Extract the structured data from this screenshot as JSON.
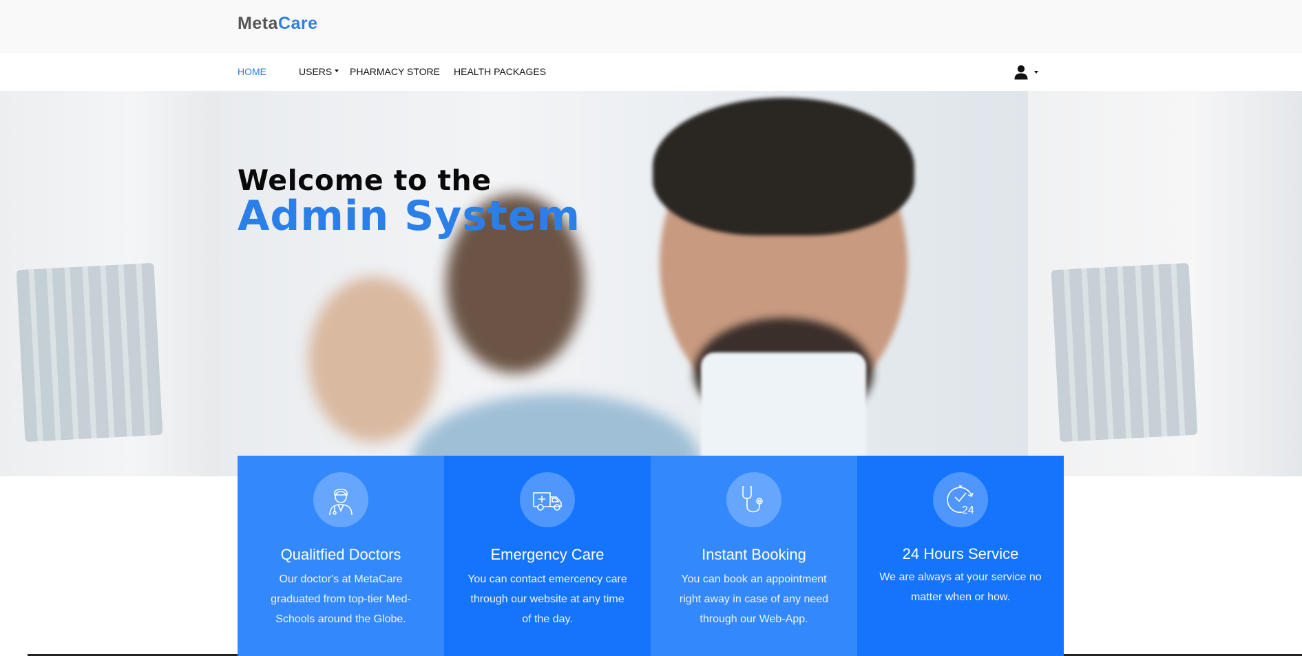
{
  "brand": {
    "part1": "Meta",
    "part2": "Care"
  },
  "nav": {
    "home": "HOME",
    "users": "USERS",
    "pharmacy": "PHARMACY STORE",
    "packages": "HEALTH PACKAGES"
  },
  "hero": {
    "line1": "Welcome to the",
    "line2": "Admin System"
  },
  "features": [
    {
      "title": "Qualitfied Doctors",
      "text": "Our doctor's at MetaCare graduated from top-tier Med-Schools around the Globe.",
      "icon": "doctor-icon"
    },
    {
      "title": "Emergency Care",
      "text": "You can contact emercency care through our website at any time of the day.",
      "icon": "ambulance-icon"
    },
    {
      "title": "Instant Booking",
      "text": "You can book an appointment right away in case of any need through our Web-App.",
      "icon": "stethoscope-icon"
    },
    {
      "title": "24 Hours Service",
      "text": "We are always at your service no matter when or how.",
      "icon": "clock-24-icon"
    }
  ],
  "colors": {
    "accent": "#2b7fe8",
    "card_light": "#3388fc",
    "card_dark": "#1574fc"
  }
}
